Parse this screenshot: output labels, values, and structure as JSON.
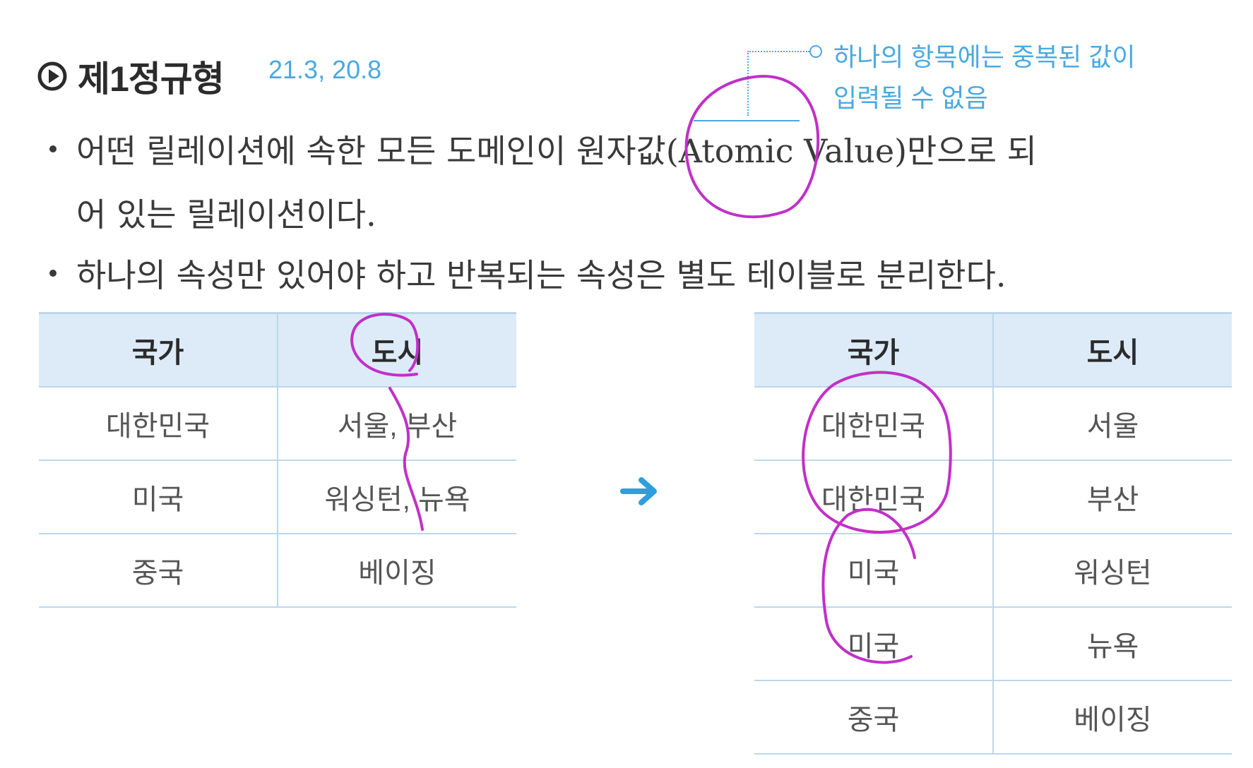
{
  "heading": {
    "title": "제1정규형",
    "years": "21.3, 20.8"
  },
  "note": {
    "line1": "하나의 항목에는 중복된 값이",
    "line2": "입력될 수 없음"
  },
  "bullets": {
    "b1_line1": "어떤 릴레이션에 속한 모든 도메인이 원자값(Atomic Value)만으로 되",
    "b1_line2": "어 있는 릴레이션이다.",
    "b2": "하나의 속성만 있어야 하고 반복되는 속성은 별도 테이블로 분리한다."
  },
  "left_table": {
    "headers": [
      "국가",
      "도시"
    ],
    "rows": [
      [
        "대한민국",
        "서울, 부산"
      ],
      [
        "미국",
        "워싱턴, 뉴욕"
      ],
      [
        "중국",
        "베이징"
      ]
    ]
  },
  "right_table": {
    "headers": [
      "국가",
      "도시"
    ],
    "rows": [
      [
        "대한민국",
        "서울"
      ],
      [
        "대한민국",
        "부산"
      ],
      [
        "미국",
        "워싱턴"
      ],
      [
        "미국",
        "뉴욕"
      ],
      [
        "중국",
        "베이징"
      ]
    ]
  },
  "colors": {
    "accent": "#4aa9e0",
    "header_bg": "#dcebf7",
    "ink": "#c22fc9"
  },
  "icons": {
    "heading": "play-circle-icon",
    "transform": "arrow-right-icon"
  }
}
